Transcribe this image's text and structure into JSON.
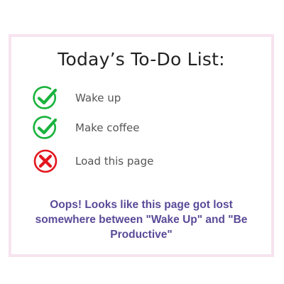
{
  "colors": {
    "card_border": "#f7e3ef",
    "title": "#222222",
    "item_text": "#555555",
    "check_green": "#19b33c",
    "cross_red": "#e3161e",
    "message": "#5a4a98"
  },
  "title": "Today’s To-Do List:",
  "items": [
    {
      "label": "Wake up",
      "status": "done",
      "icon": "check-circle-icon"
    },
    {
      "label": "Make coffee",
      "status": "done",
      "icon": "check-circle-icon"
    },
    {
      "label": "Load this page",
      "status": "failed",
      "icon": "cross-circle-icon"
    }
  ],
  "message": "Oops! Looks like this page got lost somewhere between \"Wake Up\" and \"Be Productive\""
}
